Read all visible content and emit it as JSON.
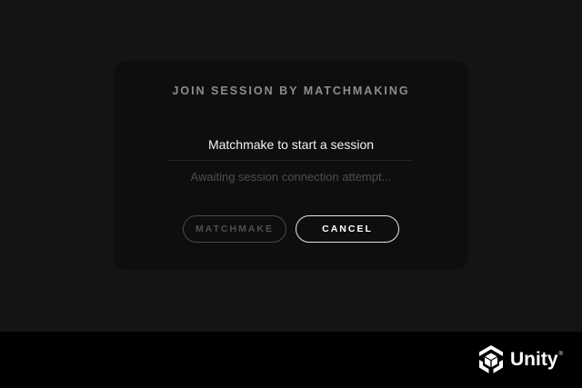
{
  "dialog": {
    "title": "JOIN SESSION BY MATCHMAKING",
    "prompt": "Matchmake to start a session",
    "status": "Awaiting session connection attempt...",
    "matchmake_label": "MATCHMAKE",
    "cancel_label": "CANCEL",
    "matchmake_enabled": false
  },
  "branding": {
    "name": "Unity",
    "trademark": "®",
    "icon": "unity-cube-icon"
  },
  "colors": {
    "background": "#141414",
    "dialog": "#0e0e0e",
    "accent_text": "#ffffff",
    "muted_text": "#8d8d8d"
  }
}
